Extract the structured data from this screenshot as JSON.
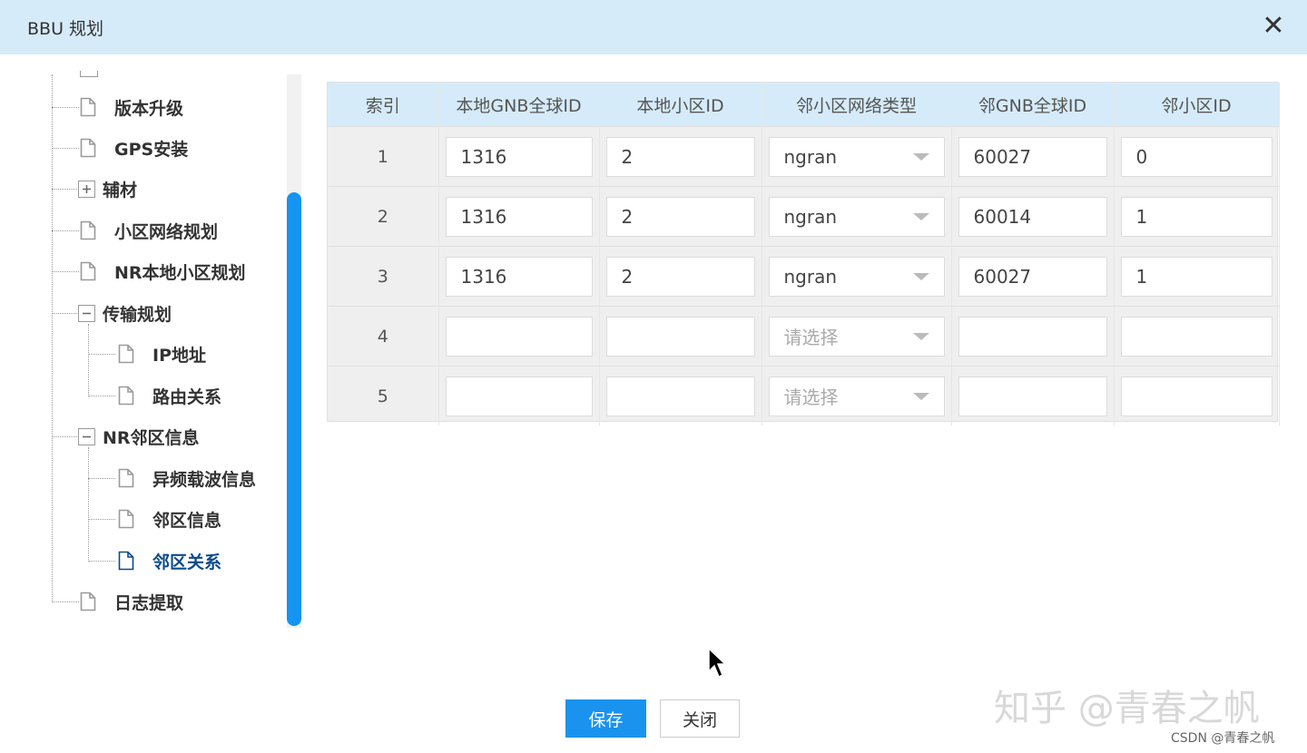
{
  "window": {
    "title": "BBU 规划",
    "close_glyph": "✕"
  },
  "tree": {
    "items": [
      {
        "label": "版本升级",
        "icon": "document-icon"
      },
      {
        "label": "GPS安装",
        "icon": "document-icon"
      },
      {
        "label": "辅材",
        "icon": "expand-plus-icon"
      },
      {
        "label": "小区网络规划",
        "icon": "document-icon"
      },
      {
        "label": "NR本地小区规划",
        "icon": "document-icon"
      },
      {
        "label": "传输规划",
        "icon": "collapse-minus-icon"
      },
      {
        "label": "IP地址",
        "icon": "document-icon"
      },
      {
        "label": "路由关系",
        "icon": "document-icon"
      },
      {
        "label": "NR邻区信息",
        "icon": "collapse-minus-icon"
      },
      {
        "label": "异频载波信息",
        "icon": "document-icon"
      },
      {
        "label": "邻区信息",
        "icon": "document-icon"
      },
      {
        "label": "邻区关系",
        "icon": "document-icon",
        "selected": true
      },
      {
        "label": "日志提取",
        "icon": "document-icon"
      }
    ]
  },
  "table": {
    "columns": [
      "索引",
      "本地GNB全球ID",
      "本地小区ID",
      "邻小区网络类型",
      "邻GNB全球ID",
      "邻小区ID"
    ],
    "rows": [
      {
        "index": "1",
        "local_gnb": "1316",
        "local_cell": "2",
        "net_type": "ngran",
        "nbr_gnb": "60027",
        "nbr_cell": "0"
      },
      {
        "index": "2",
        "local_gnb": "1316",
        "local_cell": "2",
        "net_type": "ngran",
        "nbr_gnb": "60014",
        "nbr_cell": "1"
      },
      {
        "index": "3",
        "local_gnb": "1316",
        "local_cell": "2",
        "net_type": "ngran",
        "nbr_gnb": "60027",
        "nbr_cell": "1"
      },
      {
        "index": "4",
        "local_gnb": "",
        "local_cell": "",
        "net_type": "",
        "nbr_gnb": "",
        "nbr_cell": ""
      },
      {
        "index": "5",
        "local_gnb": "",
        "local_cell": "",
        "net_type": "",
        "nbr_gnb": "",
        "nbr_cell": ""
      }
    ],
    "select_placeholder": "请选择"
  },
  "buttons": {
    "save": "保存",
    "close": "关闭"
  },
  "watermarks": {
    "main": "知乎 @青春之帆",
    "csdn": "CSDN @青春之帆"
  },
  "colors": {
    "header_bg": "#d6ebf9",
    "accent": "#1a93ee",
    "selected_text": "#0b4a8a"
  }
}
